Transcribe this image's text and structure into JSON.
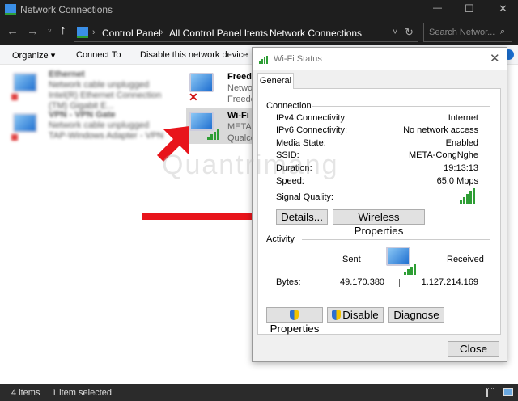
{
  "window": {
    "title": "Network Connections",
    "minimize": "—",
    "maximize": "☐",
    "close": "✕"
  },
  "address": {
    "breadcrumb": [
      "Control Panel",
      "All Control Panel Items",
      "Network Connections"
    ],
    "search_placeholder": "Search Networ..."
  },
  "toolbar": {
    "organize": "Organize ▾",
    "connect_to": "Connect To",
    "disable": "Disable this network device"
  },
  "connections": [
    {
      "name": "Ethernet",
      "status": "Network cable unplugged",
      "device": "Intel(R) Ethernet Connection (TM) Gigabit E..."
    },
    {
      "name": "VPN - VPN Gate",
      "status": "Network cable unplugged",
      "device": "TAP-Windows Adapter - VPN"
    },
    {
      "name": "Freedo",
      "status": "Netwo",
      "device": "Freedo"
    },
    {
      "name": "Wi-Fi",
      "status": "META-",
      "device": "Qualco"
    }
  ],
  "statusbar": {
    "items": "4 items",
    "selected": "1 item selected"
  },
  "dialog": {
    "title": "Wi-Fi Status",
    "tab": "General",
    "connection_label": "Connection",
    "rows": [
      {
        "label": "IPv4 Connectivity:",
        "value": "Internet"
      },
      {
        "label": "IPv6 Connectivity:",
        "value": "No network access"
      },
      {
        "label": "Media State:",
        "value": "Enabled"
      },
      {
        "label": "SSID:",
        "value": "META-CongNghe"
      },
      {
        "label": "Duration:",
        "value": "19:13:13"
      },
      {
        "label": "Speed:",
        "value": "65.0 Mbps"
      }
    ],
    "signal_label": "Signal Quality:",
    "signal_bars": 5,
    "details": "Details...",
    "wireless_properties": "Wireless Properties",
    "activity_label": "Activity",
    "sent": "Sent",
    "received": "Received",
    "bytes_label": "Bytes:",
    "bytes_sent": "49.170.380",
    "bytes_received": "1.127.214.169",
    "properties": "Properties",
    "disable": "Disable",
    "diagnose": "Diagnose",
    "close": "Close"
  },
  "watermark": "Quantrimang",
  "colors": {
    "accent_arrow": "#e8141b",
    "signal": "#2e9e35"
  }
}
